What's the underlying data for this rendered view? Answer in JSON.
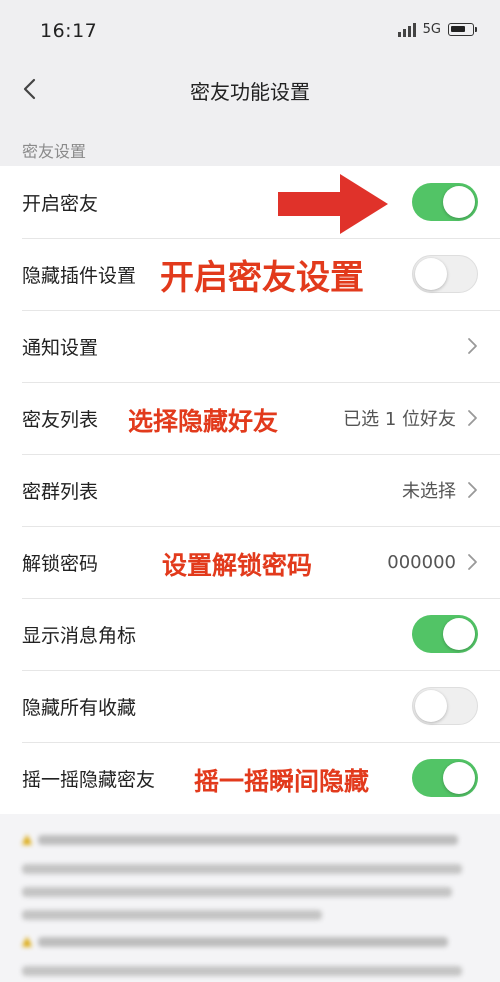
{
  "status_bar": {
    "time": "16:17",
    "network": "5G"
  },
  "nav": {
    "title": "密友功能设置"
  },
  "section": {
    "label": "密友设置"
  },
  "rows": [
    {
      "label": "开启密友",
      "type": "toggle",
      "on": true
    },
    {
      "label": "隐藏插件设置",
      "type": "toggle",
      "on": false
    },
    {
      "label": "通知设置",
      "type": "link",
      "value": ""
    },
    {
      "label": "密友列表",
      "type": "link",
      "value": "已选 1 位好友"
    },
    {
      "label": "密群列表",
      "type": "link",
      "value": "未选择"
    },
    {
      "label": "解锁密码",
      "type": "link",
      "value": "000000"
    },
    {
      "label": "显示消息角标",
      "type": "toggle",
      "on": true
    },
    {
      "label": "隐藏所有收藏",
      "type": "toggle",
      "on": false
    },
    {
      "label": "摇一摇隐藏密友",
      "type": "toggle",
      "on": true
    }
  ],
  "annotations": {
    "enable_settings": "开启密友设置",
    "choose_hidden": "选择隐藏好友",
    "set_password": "设置解锁密码",
    "shake_hide": "摇一摇瞬间隐藏"
  },
  "colors": {
    "toggle_on": "#52c466",
    "annotation": "#e23a1c",
    "arrow": "#e0322a"
  }
}
